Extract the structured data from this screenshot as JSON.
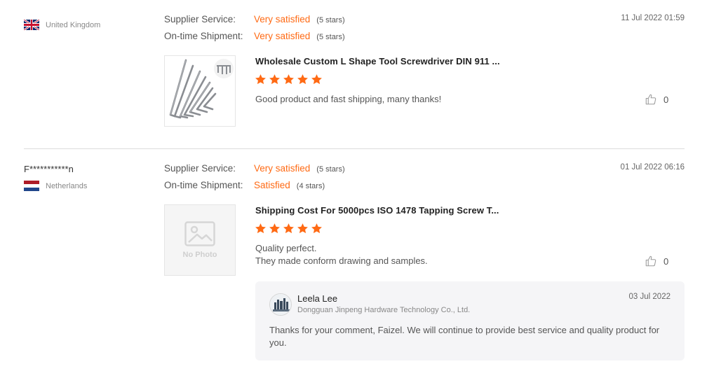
{
  "colors": {
    "accent": "#ff6a14",
    "divider": "#dcdcdc",
    "reply_bg": "#f5f5f7"
  },
  "reviews": [
    {
      "reviewer": "",
      "country": "United Kingdom",
      "flag": "uk-flag-icon",
      "date": "11 Jul 2022 01:59",
      "supplier_service": {
        "label": "Supplier Service:",
        "value": "Very satisfied",
        "stars_text": "(5 stars)"
      },
      "shipment": {
        "label": "On-time Shipment:",
        "value": "Very satisfied",
        "stars_text": "(5 stars)"
      },
      "product_title": "Wholesale Custom L Shape Tool Screwdriver DIN 911 ...",
      "rating": 5,
      "comment": [
        "Good product and fast shipping, many thanks!"
      ],
      "likes": "0"
    },
    {
      "reviewer": "F***********n",
      "country": "Netherlands",
      "flag": "netherlands-flag-icon",
      "date": "01 Jul 2022 06:16",
      "supplier_service": {
        "label": "Supplier Service:",
        "value": "Very satisfied",
        "stars_text": "(5 stars)"
      },
      "shipment": {
        "label": "On-time Shipment:",
        "value": "Satisfied",
        "stars_text": "(4 stars)"
      },
      "product_title": "Shipping Cost For 5000pcs ISO 1478 Tapping Screw T...",
      "no_photo_text": "No Photo",
      "rating": 5,
      "comment": [
        "Quality perfect.",
        "They made conform drawing and samples."
      ],
      "likes": "0",
      "reply": {
        "name": "Leela Lee",
        "company": "Dongguan Jinpeng Hardware Technology Co., Ltd.",
        "date": "03 Jul 2022",
        "text": "Thanks for your comment, Faizel. We will continue to provide best service and quality product for you."
      }
    }
  ]
}
